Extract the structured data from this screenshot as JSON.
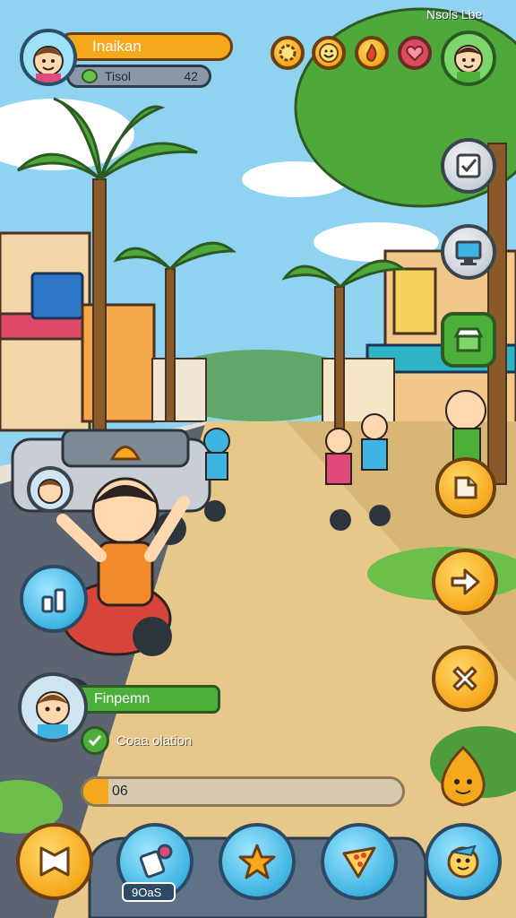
{
  "hud": {
    "player_name": "Inaikan",
    "stat_label": "Tisol",
    "stat_value": "42",
    "top_right_label": "Nsols Lbe",
    "currency_icons": [
      "gear-coin-icon",
      "smile-coin-icon",
      "fire-coin-icon",
      "heart-coin-icon"
    ]
  },
  "side_actions": [
    "checklist-icon",
    "computer-icon",
    "shop-icon"
  ],
  "right_actions": [
    "map-icon",
    "arrow-right-icon",
    "close-x-icon"
  ],
  "notification": {
    "name": "Finpemn",
    "message": "Coaa olation"
  },
  "progress": {
    "label": "06",
    "fraction": 0.08
  },
  "bottom_bar": {
    "buttons": [
      "back-icon",
      "tools-icon",
      "star-icon",
      "pizza-icon",
      "character-icon"
    ],
    "badge_label": "9OaS"
  },
  "colors": {
    "orange": "#f6a81c",
    "blue": "#3fb4e2",
    "green": "#4caf3a",
    "sand": "#e7c88a"
  }
}
